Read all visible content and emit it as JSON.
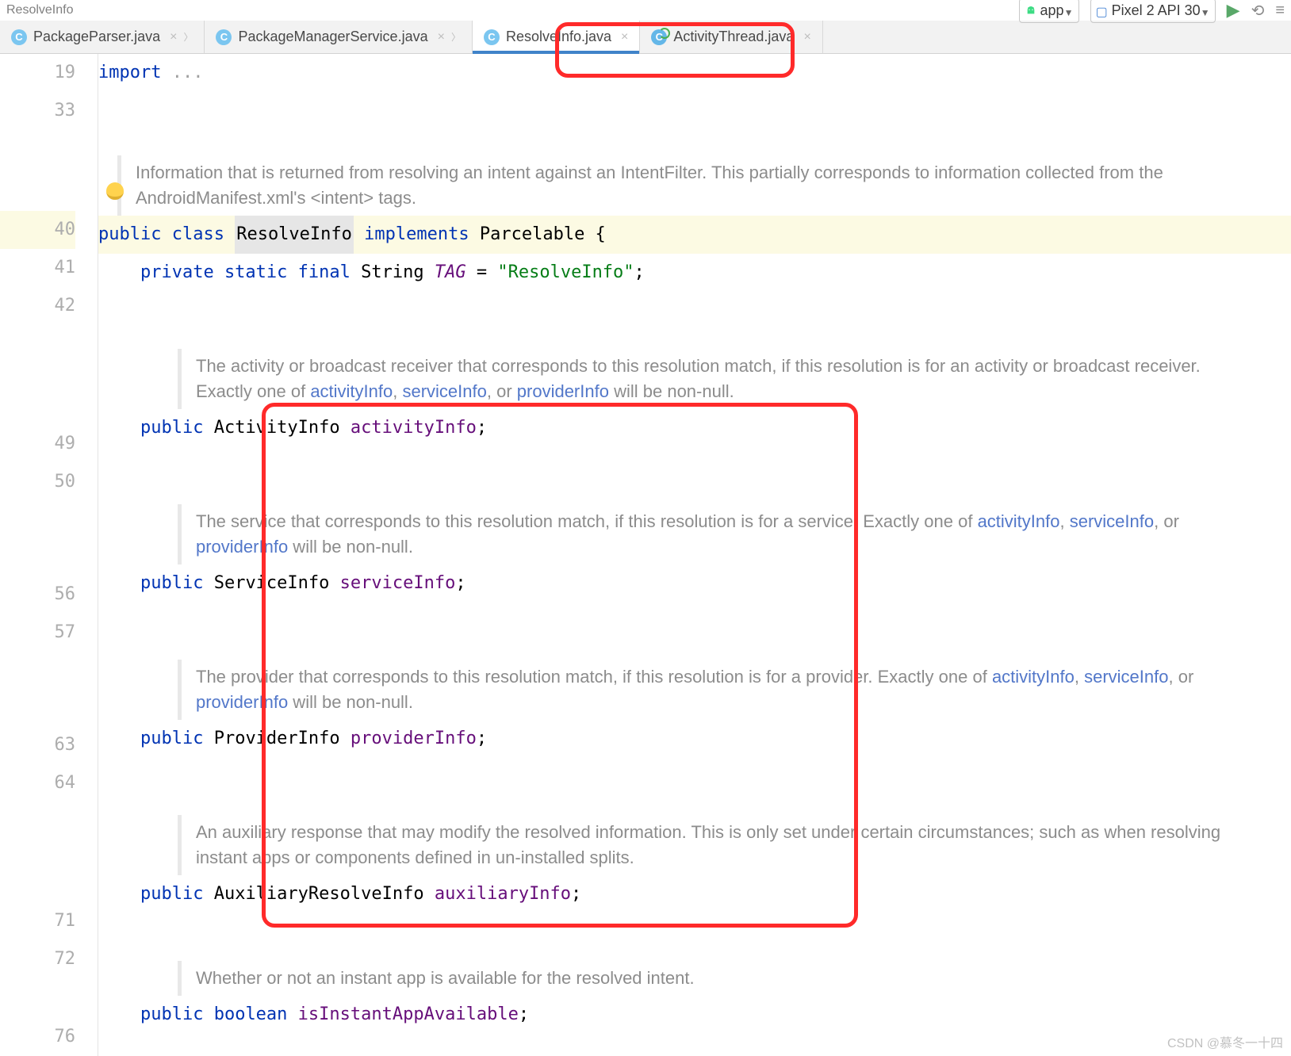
{
  "breadcrumb": "ResolveInfo",
  "run_config": "app",
  "device": "Pixel 2 API 30",
  "tabs": [
    {
      "label": "PackageParser.java"
    },
    {
      "label": "PackageManagerService.java"
    },
    {
      "label": "ResolveInfo.java"
    },
    {
      "label": "ActivityThread.java"
    }
  ],
  "gutter": [
    "19",
    "33",
    "",
    "",
    "40",
    "41",
    "42",
    "",
    "",
    "",
    "49",
    "50",
    "",
    "",
    "",
    "56",
    "57",
    "",
    "",
    "",
    "63",
    "64",
    "",
    "",
    "",
    "71",
    "72",
    "",
    "",
    "76"
  ],
  "code": {
    "import_kw": "import ",
    "fold": "...",
    "doc1": "Information that is returned from resolving an intent against an IntentFilter. This partially corresponds to information collected from the AndroidManifest.xml's <intent> tags.",
    "l40_public": "public ",
    "l40_class": "class ",
    "l40_name": "ResolveInfo",
    "l40_impl": " implements ",
    "l40_parcel": "Parcelable {",
    "l41_priv": "    private static final ",
    "l41_type": "String ",
    "l41_tag": "TAG",
    "l41_eq": " = ",
    "l41_str": "\"ResolveInfo\"",
    "l41_semi": ";",
    "doc2a": "The activity or broadcast receiver that corresponds to this resolution match, if this resolution is for an activity or broadcast receiver. Exactly one of ",
    "ai": "activityInfo",
    "c": ", ",
    "si": "serviceInfo",
    "or": ", or ",
    "pi": "providerInfo",
    "nn": " will be non-null.",
    "l49_pub": "    public ",
    "l49_type": "ActivityInfo ",
    "l49_field": "activityInfo",
    "semi": ";",
    "doc3a": "The service that corresponds to this resolution match, if this resolution is for a service. Exactly one of ",
    "l56_pub": "    public ",
    "l56_type": "ServiceInfo ",
    "l56_field": "serviceInfo",
    "doc4a": "The provider that corresponds to this resolution match, if this resolution is for a provider. Exactly one of ",
    "l63_pub": "    public ",
    "l63_type": "ProviderInfo ",
    "l63_field": "providerInfo",
    "doc5": "An auxiliary response that may modify the resolved information. This is only set under certain circumstances; such as when resolving instant apps or components defined in un-installed splits.",
    "l71_pub": "    public ",
    "l71_type": "AuxiliaryResolveInfo ",
    "l71_field": "auxiliaryInfo",
    "doc6": "Whether or not an instant app is available for the resolved intent.",
    "l76_pub": "    public ",
    "l76_bool": "boolean ",
    "l76_field": "isInstantAppAvailable"
  },
  "watermark": "CSDN @慕冬一十四"
}
